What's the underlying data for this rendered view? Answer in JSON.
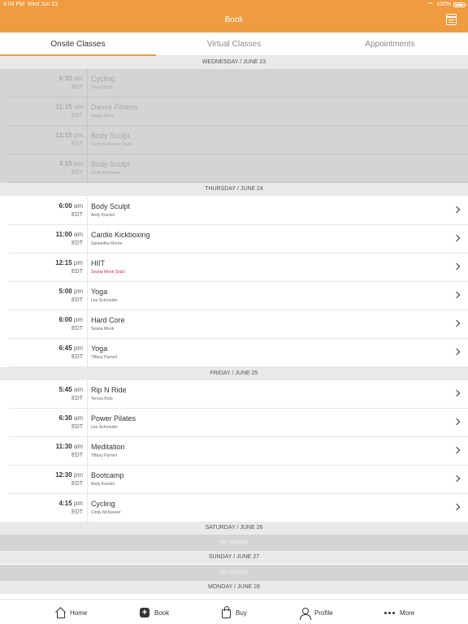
{
  "status": {
    "time": "6:04 PM",
    "date": "Wed Jun 23",
    "battery": "100%"
  },
  "header": {
    "title": "Book",
    "calendar_icon": "calendar-icon"
  },
  "tabs": [
    {
      "label": "Onsite Classes",
      "active": true
    },
    {
      "label": "Virtual Classes",
      "active": false
    },
    {
      "label": "Appointments",
      "active": false
    }
  ],
  "days": {
    "wed": "WEDNESDAY / JUNE 23",
    "thu": "THURSDAY / JUNE 24",
    "fri": "FRIDAY / JUNE 25",
    "sat": "SATURDAY / JUNE 26",
    "sun": "SUNDAY / JUNE 27",
    "mon": "MONDAY / JUNE 28"
  },
  "no_classes": "No classes",
  "wed_classes": [
    {
      "time": "6:30",
      "ampm": "am",
      "tz": "EDT",
      "name": "Cycling",
      "instructor": "Teresa Bufo"
    },
    {
      "time": "11:15",
      "ampm": "am",
      "tz": "EDT",
      "name": "Dance Fitness",
      "instructor": "Seana Minck"
    },
    {
      "time": "12:15",
      "ampm": "pm",
      "tz": "EDT",
      "name": "Body Sculpt",
      "instructor": "Cindy McKeever (Sub)"
    },
    {
      "time": "4:15",
      "ampm": "pm",
      "tz": "EDT",
      "name": "Body Sculpt",
      "instructor": "Cindy McKeever"
    }
  ],
  "thu_classes": [
    {
      "time": "6:00",
      "ampm": "am",
      "tz": "EDT",
      "name": "Body Sculpt",
      "instructor": "Andy Kessler"
    },
    {
      "time": "11:00",
      "ampm": "am",
      "tz": "EDT",
      "name": "Cardio Kickboxing",
      "instructor": "Samantha Moore"
    },
    {
      "time": "12:15",
      "ampm": "pm",
      "tz": "EDT",
      "name": "HIIT",
      "instructor": "Seana Monk (Sub)"
    },
    {
      "time": "5:00",
      "ampm": "pm",
      "tz": "EDT",
      "name": "Yoga",
      "instructor": "Lee Schroeder"
    },
    {
      "time": "6:00",
      "ampm": "pm",
      "tz": "EDT",
      "name": "Hard Core",
      "instructor": "Seana Monk"
    },
    {
      "time": "6:45",
      "ampm": "pm",
      "tz": "EDT",
      "name": "Yoga",
      "instructor": "Tiffany Purnell"
    }
  ],
  "fri_classes": [
    {
      "time": "5:45",
      "ampm": "am",
      "tz": "EDT",
      "name": "Rip N Ride",
      "instructor": "Teresa Bufo"
    },
    {
      "time": "6:30",
      "ampm": "am",
      "tz": "EDT",
      "name": "Power Pilates",
      "instructor": "Lee Schroeder"
    },
    {
      "time": "11:30",
      "ampm": "am",
      "tz": "EDT",
      "name": "Meditation",
      "instructor": "Tiffany Purnell"
    },
    {
      "time": "12:30",
      "ampm": "pm",
      "tz": "EDT",
      "name": "Bootcamp",
      "instructor": "Andy Kessler"
    },
    {
      "time": "4:15",
      "ampm": "pm",
      "tz": "EDT",
      "name": "Cycling",
      "instructor": "Cindy McKeever"
    }
  ],
  "nav": [
    {
      "label": "Home",
      "icon": "home-icon"
    },
    {
      "label": "Book",
      "icon": "book-plus-icon"
    },
    {
      "label": "Buy",
      "icon": "shopping-bag-icon"
    },
    {
      "label": "Profile",
      "icon": "person-icon"
    },
    {
      "label": "More",
      "icon": "more-dots-icon"
    }
  ],
  "colors": {
    "accent": "#ef9b3f",
    "sub_instructor": "#d7263d",
    "past_bg": "#d4d4d4"
  }
}
